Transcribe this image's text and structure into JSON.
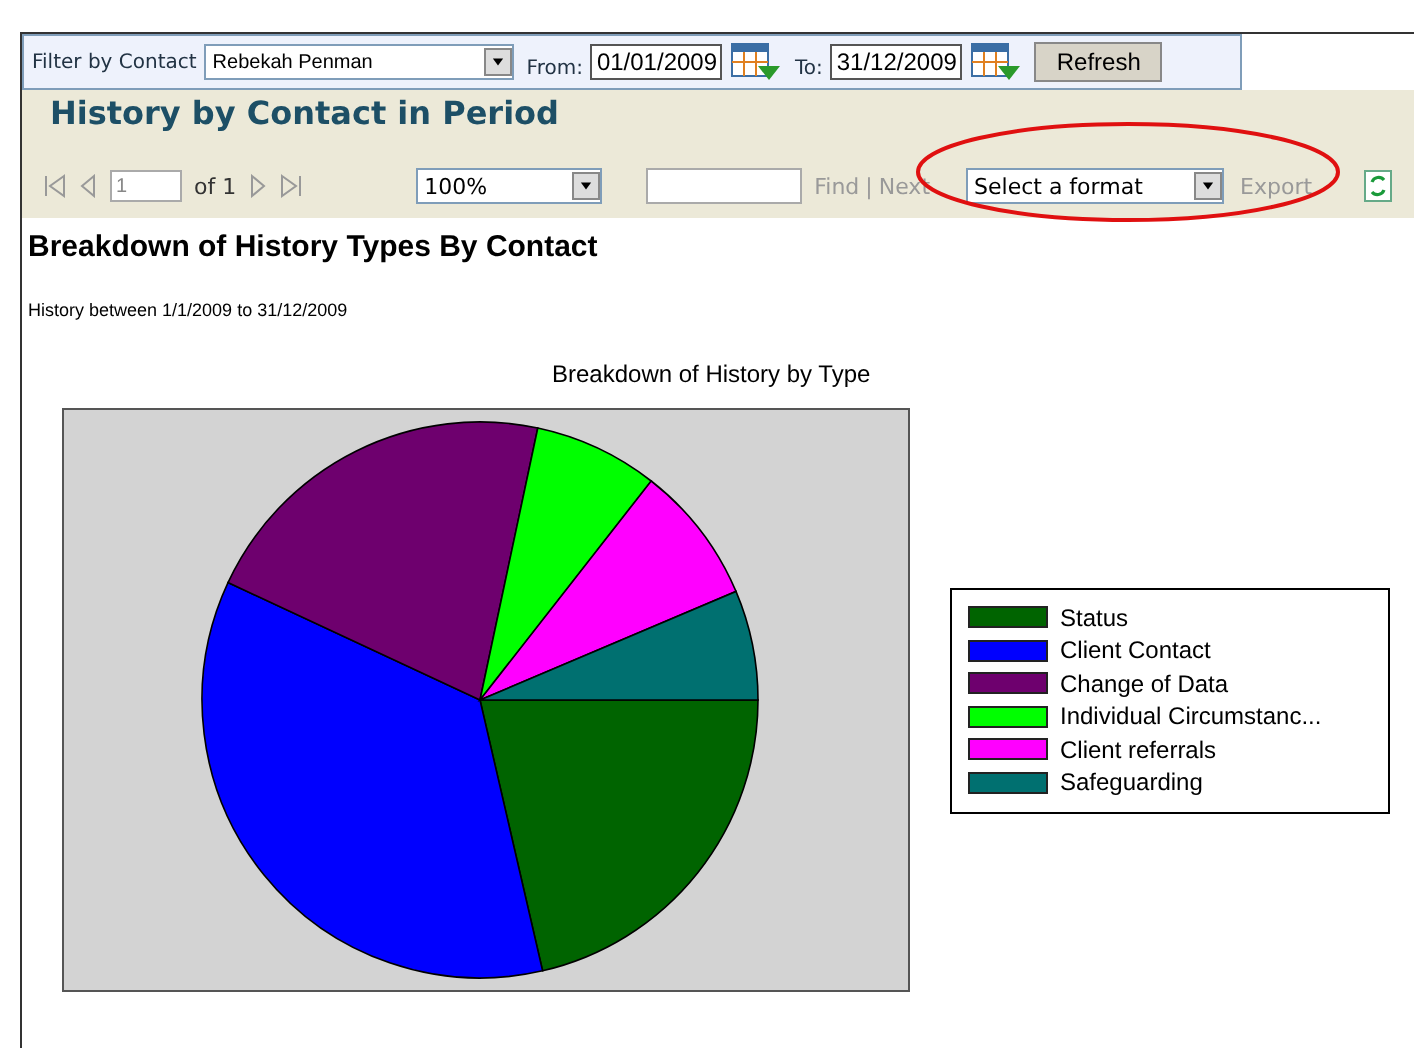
{
  "filter": {
    "label": "Filter by Contact",
    "contact": "Rebekah Penman",
    "from_label": "From:",
    "from": "01/01/2009",
    "to_label": "To:",
    "to": "31/12/2009",
    "refresh": "Refresh"
  },
  "report": {
    "title": "History by Contact in Period"
  },
  "toolbar": {
    "page": "1",
    "page_of": "of 1",
    "zoom": "100%",
    "find": "Find",
    "separator": "|",
    "next": "Next",
    "format": "Select a format",
    "export": "Export"
  },
  "content": {
    "heading": "Breakdown of History Types By Contact",
    "subtitle": "History between 1/1/2009 to 31/12/2009",
    "chart_title": "Breakdown of History by Type",
    "legend": [
      {
        "label": "Status",
        "color": "#006400"
      },
      {
        "label": "Client Contact",
        "color": "#0000ff"
      },
      {
        "label": "Change of Data",
        "color": "#6e006e"
      },
      {
        "label": "Individual Circumstanc...",
        "color": "#00ff00"
      },
      {
        "label": "Client referrals",
        "color": "#ff00ff"
      },
      {
        "label": "Safeguarding",
        "color": "#007070"
      }
    ]
  }
}
